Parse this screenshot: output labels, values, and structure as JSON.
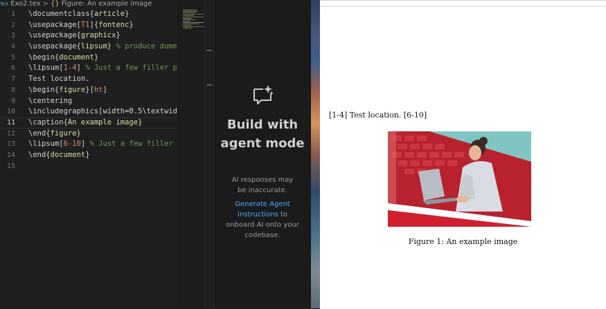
{
  "breadcrumb": {
    "file_icon": "TeX",
    "file": "Exo2.tex",
    "separator": ">",
    "symbol_icon": "{}",
    "symbol": "Figure: An example image"
  },
  "editor": {
    "current_line": 11,
    "lines": [
      {
        "n": "1",
        "text": "\\documentclass{article}"
      },
      {
        "n": "2",
        "text": "\\usepackage[T1]{fontenc}"
      },
      {
        "n": "3",
        "text": "\\usepackage{graphicx}"
      },
      {
        "n": "4",
        "text": "\\usepackage{lipsum} % produce dumm"
      },
      {
        "n": "5",
        "text": "\\begin{document}"
      },
      {
        "n": "6",
        "text": "\\lipsum[1-4] % Just a few filler p"
      },
      {
        "n": "7",
        "text": "Test location."
      },
      {
        "n": "8",
        "text": "\\begin{figure}[ht]"
      },
      {
        "n": "9",
        "text": "\\centering"
      },
      {
        "n": "10",
        "text": "\\includegraphics[width=0.5\\textwid"
      },
      {
        "n": "11",
        "text": "\\caption{An example image}"
      },
      {
        "n": "12",
        "text": "\\end{figure}"
      },
      {
        "n": "13",
        "text": "\\lipsum[6-10] % Just a few filler "
      },
      {
        "n": "14",
        "text": "\\end{document}"
      },
      {
        "n": "15",
        "text": ""
      }
    ]
  },
  "agent_panel": {
    "icon": "chat-sparkle-icon",
    "title": "Build with agent mode",
    "disclaimer": "AI responses may be inaccurate.",
    "link": "Generate Agent Instructions",
    "link_suffix": "to onboard AI onto your codebase."
  },
  "pdf": {
    "body_text": "[1-4] Test location. [6-10]",
    "caption": "Figure 1: An example image"
  },
  "colors": {
    "editor_bg": "#1f1f1f",
    "link": "#4daafc",
    "figure_red": "#d0202e",
    "figure_teal": "#7fc6c2"
  }
}
